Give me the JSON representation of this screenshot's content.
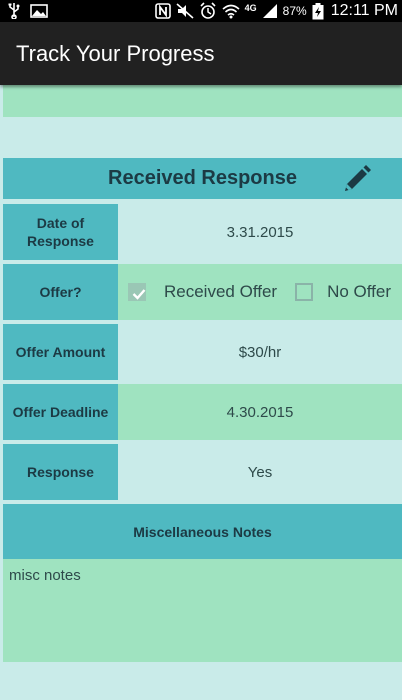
{
  "status_bar": {
    "battery_percent": "87%",
    "time": "12:11 PM",
    "network": "4G",
    "icons": [
      "usb-icon",
      "image-icon",
      "nfc-icon",
      "mute-icon",
      "alarm-icon",
      "wifi-icon",
      "signal-icon",
      "battery-charging-icon"
    ]
  },
  "app": {
    "title": "Track Your Progress"
  },
  "card": {
    "heading": "Received Response",
    "edit_icon": "pencil-icon",
    "rows": {
      "date": {
        "label": "Date of Response",
        "value": "3.31.2015"
      },
      "offer": {
        "label": "Offer?",
        "options": [
          {
            "label": "Received Offer",
            "checked": true
          },
          {
            "label": "No Offer",
            "checked": false
          }
        ]
      },
      "amount": {
        "label": "Offer Amount",
        "value": "$30/hr"
      },
      "deadline": {
        "label": "Offer Deadline",
        "value": "4.30.2015"
      },
      "response": {
        "label": "Response",
        "value": "Yes"
      }
    },
    "notes": {
      "heading": "Miscellaneous Notes",
      "text": "misc notes"
    }
  },
  "colors": {
    "header_teal": "#4fb9c1",
    "light_bg": "#c9ebe9",
    "green_bg": "#9fe3c0",
    "action_bar": "#212121"
  }
}
